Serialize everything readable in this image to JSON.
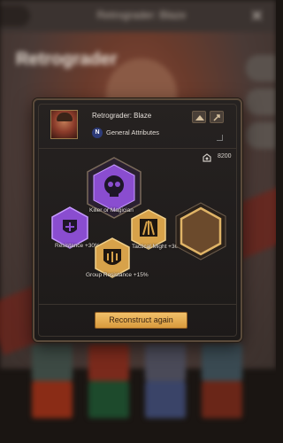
{
  "background": {
    "window_title": "Retrograder: Blaze",
    "hero_name_banner": "Retrograder",
    "close_icon": "close-icon",
    "back_icon": "back-icon"
  },
  "modal": {
    "hero_name": "Retrograder: Blaze",
    "rarity_badge": "N",
    "subtitle": "General Attributes",
    "currency_amount": "8200",
    "nodes": {
      "center": "Killer or Magician",
      "left": "Resistance +30%",
      "right": "Tactical Might +30%",
      "bottom": "Group Resistance +15%"
    },
    "reconstruct_label": "Reconstruct again"
  },
  "colors": {
    "purple": "#8a4dd0",
    "gold": "#d7a24a",
    "cta": "#e7ad4f"
  }
}
